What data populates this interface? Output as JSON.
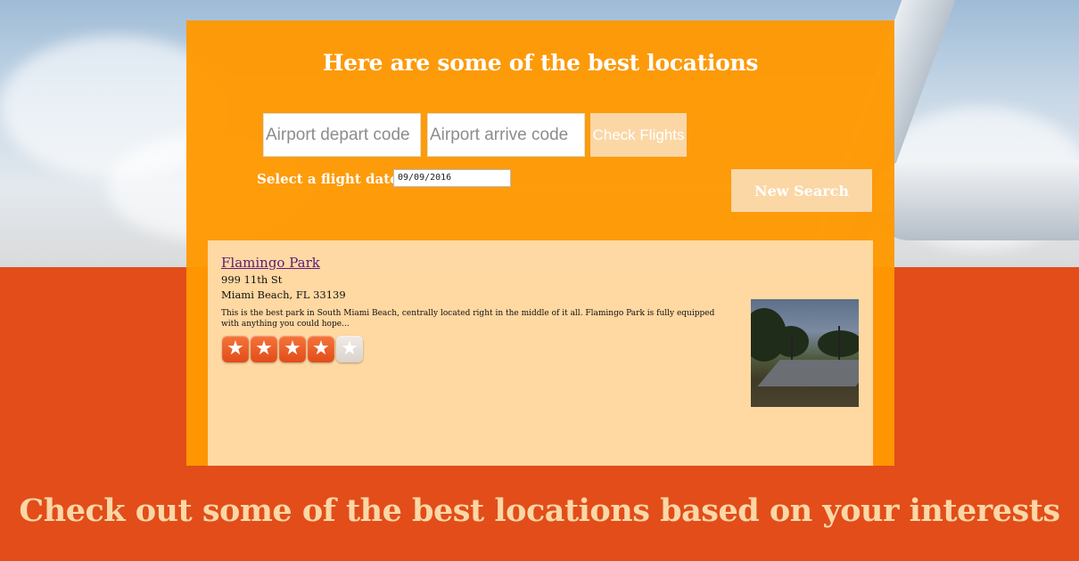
{
  "header": {
    "title": "Here are some of the best locations"
  },
  "search": {
    "depart_placeholder": "Airport depart code",
    "arrive_placeholder": "Airport arrive code",
    "check_flights_label": "Check Flights",
    "date_label": "Select a flight date:",
    "date_value": "09/09/2016",
    "new_search_label": "New Search"
  },
  "result": {
    "name": "Flamingo Park",
    "address_line1": "999 11th St",
    "address_line2": "Miami Beach, FL 33139",
    "description": "This is the best park in South Miami Beach, centrally located right in the middle of it all. Flamingo Park is fully equipped with anything you could hope...",
    "rating": 4,
    "rating_max": 5,
    "star_icon": "star-icon"
  },
  "footer": {
    "headline": "Check out some of the best locations based on your interests"
  },
  "colors": {
    "panel": "#ff9800",
    "band": "#e24d1a",
    "button": "#fbd7a6",
    "link": "#5b1c7a",
    "headline": "#fbd7a6"
  }
}
